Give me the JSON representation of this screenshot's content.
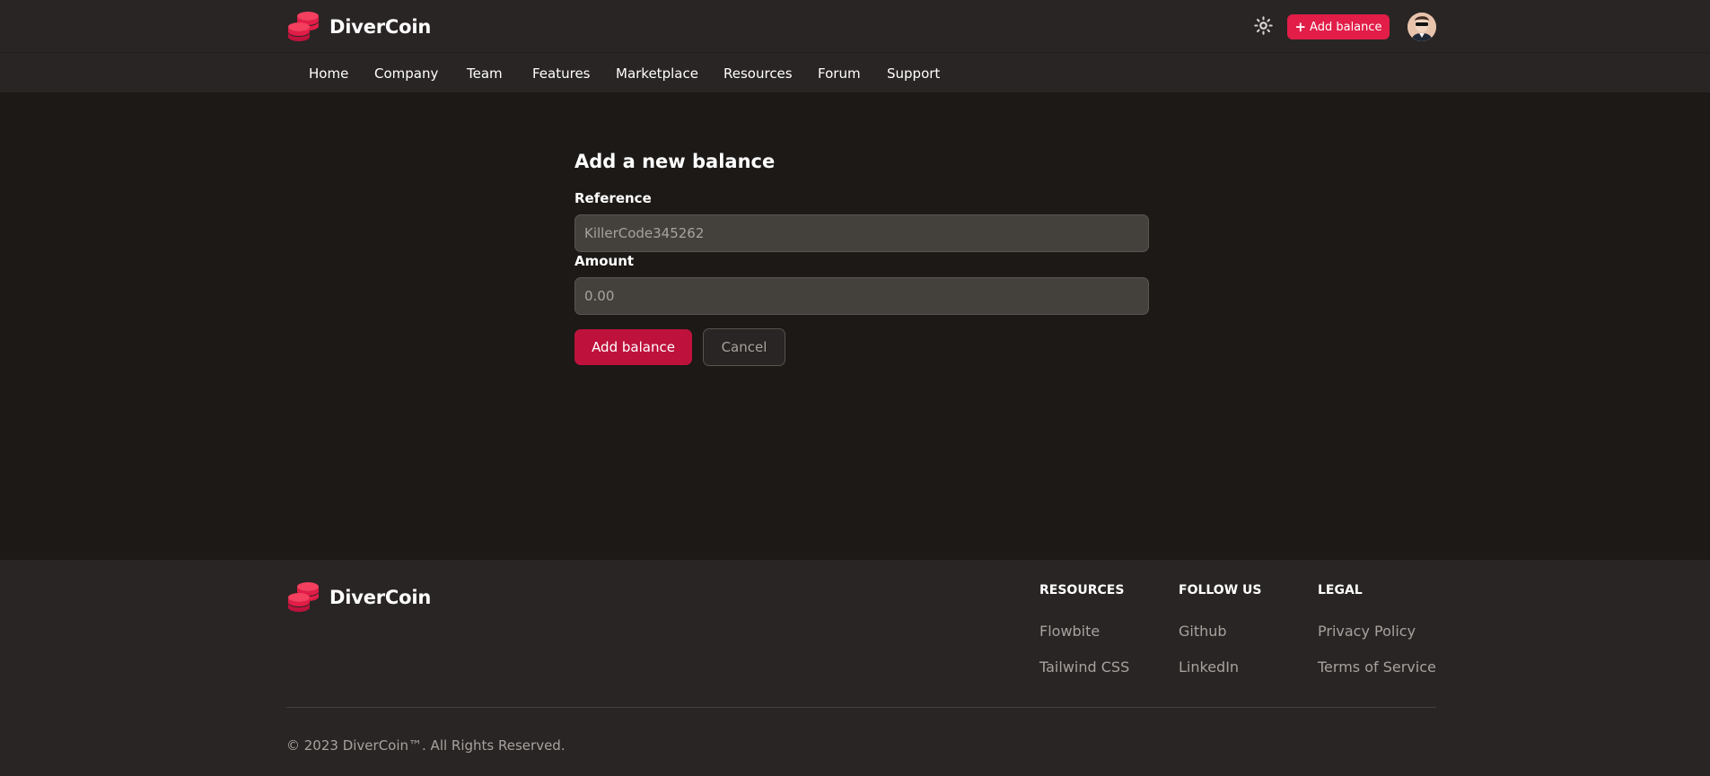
{
  "brand": {
    "name": "DiverCoin",
    "accent": "#e11d48"
  },
  "header": {
    "theme_icon": "sun-icon",
    "add_balance_label": "Add balance",
    "avatar_icon": "user-avatar"
  },
  "nav": {
    "items": [
      "Home",
      "Company",
      "Team",
      "Features",
      "Marketplace",
      "Resources",
      "Forum",
      "Support"
    ]
  },
  "form": {
    "title": "Add a new balance",
    "reference_label": "Reference",
    "reference_placeholder": "KillerCode345262",
    "amount_label": "Amount",
    "amount_placeholder": "0.00",
    "submit_label": "Add balance",
    "cancel_label": "Cancel"
  },
  "footer": {
    "brand": "DiverCoin",
    "columns": [
      {
        "heading": "Resources",
        "links": [
          "Flowbite",
          "Tailwind CSS"
        ]
      },
      {
        "heading": "Follow us",
        "links": [
          "Github",
          "LinkedIn"
        ]
      },
      {
        "heading": "Legal",
        "links": [
          "Privacy Policy",
          "Terms of Service"
        ]
      }
    ],
    "copyright": "© 2023 DiverCoin™. All Rights Reserved."
  }
}
